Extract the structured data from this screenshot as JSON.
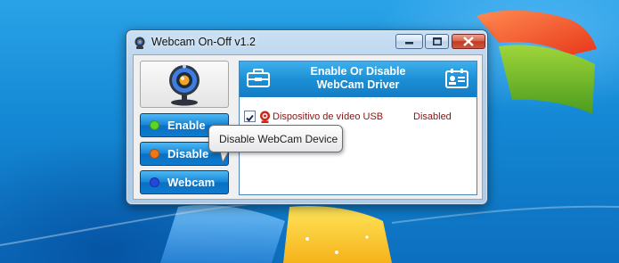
{
  "window": {
    "title": "Webcam On-Off v1.2"
  },
  "buttons": [
    {
      "label": "Enable",
      "dot_color": "#5cd42a"
    },
    {
      "label": "Disable",
      "dot_color": "#f0761a"
    },
    {
      "label": "Webcam",
      "dot_color": "#2348e0"
    }
  ],
  "panel": {
    "title": "Enable Or Disable\nWebCam Driver"
  },
  "devices": [
    {
      "name": "Dispositivo de vídeo USB",
      "status": "Disabled",
      "checked": true
    }
  ],
  "tooltip": {
    "text": "Disable WebCam Device"
  },
  "colors": {
    "accent": "#1c8fd6",
    "device_text": "#8b1212"
  }
}
